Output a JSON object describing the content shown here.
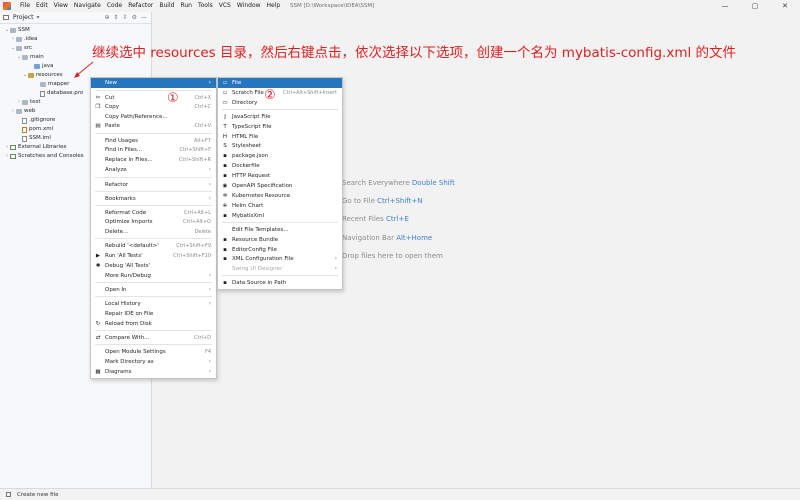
{
  "menubar": {
    "items": [
      "File",
      "Edit",
      "View",
      "Navigate",
      "Code",
      "Refactor",
      "Build",
      "Run",
      "Tools",
      "VCS",
      "Window",
      "Help"
    ],
    "window_title": "SSM [D:\\Workspace\\IDEA\\SSM]",
    "minimize": "—",
    "maximize": "▢",
    "close": "✕"
  },
  "project_panel": {
    "title": "Project",
    "dropdown": "▾",
    "tree": [
      {
        "label": "SSM",
        "arrow": "⌄",
        "icon": "folder"
      },
      {
        "label": ".idea",
        "arrow": "›",
        "icon": "folder"
      },
      {
        "label": "src",
        "arrow": "⌄",
        "icon": "folder"
      },
      {
        "label": "main",
        "arrow": "⌄",
        "icon": "folder"
      },
      {
        "label": "java",
        "arrow": "",
        "icon": "folder-src"
      },
      {
        "label": "resources",
        "arrow": "⌄",
        "icon": "folder-res"
      },
      {
        "label": "mapper",
        "arrow": "",
        "icon": "folder"
      },
      {
        "label": "database.pro",
        "arrow": "",
        "icon": "file"
      },
      {
        "label": "test",
        "arrow": "›",
        "icon": "folder"
      },
      {
        "label": "web",
        "arrow": "›",
        "icon": "folder"
      },
      {
        "label": ".gitignore",
        "arrow": "",
        "icon": "file"
      },
      {
        "label": "pom.xml",
        "arrow": "",
        "icon": "file-m"
      },
      {
        "label": "SSM.iml",
        "arrow": "",
        "icon": "file"
      },
      {
        "label": "External Libraries",
        "arrow": "›",
        "icon": "lib"
      },
      {
        "label": "Scratches and Consoles",
        "arrow": "›",
        "icon": "lib"
      }
    ]
  },
  "editor_hints": [
    {
      "text": "Search Everywhere ",
      "key": "Double Shift"
    },
    {
      "text": "Go to File ",
      "key": "Ctrl+Shift+N"
    },
    {
      "text": "Recent Files ",
      "key": "Ctrl+E"
    },
    {
      "text": "Navigation Bar ",
      "key": "Alt+Home"
    },
    {
      "text": "Drop files here to open them",
      "key": ""
    }
  ],
  "main_menu": [
    {
      "label": "New",
      "shortcut": "",
      "submenu": true,
      "selected": true,
      "icon": ""
    },
    {
      "label": "Cut",
      "shortcut": "Ctrl+X",
      "icon": "✂"
    },
    {
      "label": "Copy",
      "shortcut": "Ctrl+C",
      "icon": "❐"
    },
    {
      "label": "Copy Path/Reference...",
      "shortcut": "",
      "icon": ""
    },
    {
      "label": "Paste",
      "shortcut": "Ctrl+V",
      "icon": "▤"
    },
    {
      "label": "Find Usages",
      "shortcut": "Alt+F7",
      "icon": ""
    },
    {
      "label": "Find in Files...",
      "shortcut": "Ctrl+Shift+F",
      "icon": ""
    },
    {
      "label": "Replace in Files...",
      "shortcut": "Ctrl+Shift+R",
      "icon": ""
    },
    {
      "label": "Analyze",
      "shortcut": "",
      "submenu": true,
      "icon": ""
    },
    {
      "label": "Refactor",
      "shortcut": "",
      "submenu": true,
      "icon": ""
    },
    {
      "label": "Bookmarks",
      "shortcut": "",
      "submenu": true,
      "icon": ""
    },
    {
      "label": "Reformat Code",
      "shortcut": "Ctrl+Alt+L",
      "icon": ""
    },
    {
      "label": "Optimize Imports",
      "shortcut": "Ctrl+Alt+O",
      "icon": ""
    },
    {
      "label": "Delete...",
      "shortcut": "Delete",
      "icon": ""
    },
    {
      "label": "Rebuild '<default>'",
      "shortcut": "Ctrl+Shift+F9",
      "icon": ""
    },
    {
      "label": "Run 'All Tests'",
      "shortcut": "Ctrl+Shift+F10",
      "icon": "▶"
    },
    {
      "label": "Debug 'All Tests'",
      "shortcut": "",
      "icon": "✱"
    },
    {
      "label": "More Run/Debug",
      "shortcut": "",
      "submenu": true,
      "icon": ""
    },
    {
      "label": "Open In",
      "shortcut": "",
      "submenu": true,
      "icon": ""
    },
    {
      "label": "Local History",
      "shortcut": "",
      "submenu": true,
      "icon": ""
    },
    {
      "label": "Repair IDE on File",
      "shortcut": "",
      "icon": ""
    },
    {
      "label": "Reload from Disk",
      "shortcut": "",
      "icon": "↻"
    },
    {
      "label": "Compare With...",
      "shortcut": "Ctrl+D",
      "icon": "⇄"
    },
    {
      "label": "Open Module Settings",
      "shortcut": "F4",
      "icon": ""
    },
    {
      "label": "Mark Directory as",
      "shortcut": "",
      "submenu": true,
      "icon": ""
    },
    {
      "label": "Diagrams",
      "shortcut": "",
      "submenu": true,
      "icon": "▦"
    }
  ],
  "sub_menu": [
    {
      "label": "File",
      "shortcut": "",
      "selected": true,
      "icon": "▫"
    },
    {
      "label": "Scratch File",
      "shortcut": "Ctrl+Alt+Shift+Insert",
      "icon": "▫"
    },
    {
      "label": "Directory",
      "shortcut": "",
      "icon": "▭"
    },
    {
      "label": "JavaScript File",
      "shortcut": "",
      "icon": "J"
    },
    {
      "label": "TypeScript File",
      "shortcut": "",
      "icon": "T"
    },
    {
      "label": "HTML File",
      "shortcut": "",
      "icon": "H"
    },
    {
      "label": "Stylesheet",
      "shortcut": "",
      "icon": "S"
    },
    {
      "label": "package.json",
      "shortcut": "",
      "icon": "▪"
    },
    {
      "label": "Dockerfile",
      "shortcut": "",
      "icon": "▪"
    },
    {
      "label": "HTTP Request",
      "shortcut": "",
      "icon": "▪"
    },
    {
      "label": "OpenAPI Specification",
      "shortcut": "",
      "icon": "◉"
    },
    {
      "label": "Kubernetes Resource",
      "shortcut": "",
      "icon": "✲"
    },
    {
      "label": "Helm Chart",
      "shortcut": "",
      "icon": "⎈"
    },
    {
      "label": "MybatisXml",
      "shortcut": "",
      "icon": "▪"
    },
    {
      "label": "Edit File Templates...",
      "shortcut": "",
      "icon": ""
    },
    {
      "label": "Resource Bundle",
      "shortcut": "",
      "icon": "▪"
    },
    {
      "label": "EditorConfig File",
      "shortcut": "",
      "icon": "▪"
    },
    {
      "label": "XML Configuration File",
      "shortcut": "",
      "submenu": true,
      "icon": "▪"
    },
    {
      "label": "Swing UI Designer",
      "shortcut": "",
      "submenu": true,
      "disabled": true,
      "icon": ""
    },
    {
      "label": "Data Source in Path",
      "shortcut": "",
      "icon": "▪"
    }
  ],
  "annotation": {
    "text": "继续选中 resources 目录，然后右键点击，依次选择以下选项，创建一个名为 mybatis-config.xml 的文件",
    "step1": "①",
    "step2": "②"
  },
  "statusbar": {
    "text": "Create new file"
  }
}
